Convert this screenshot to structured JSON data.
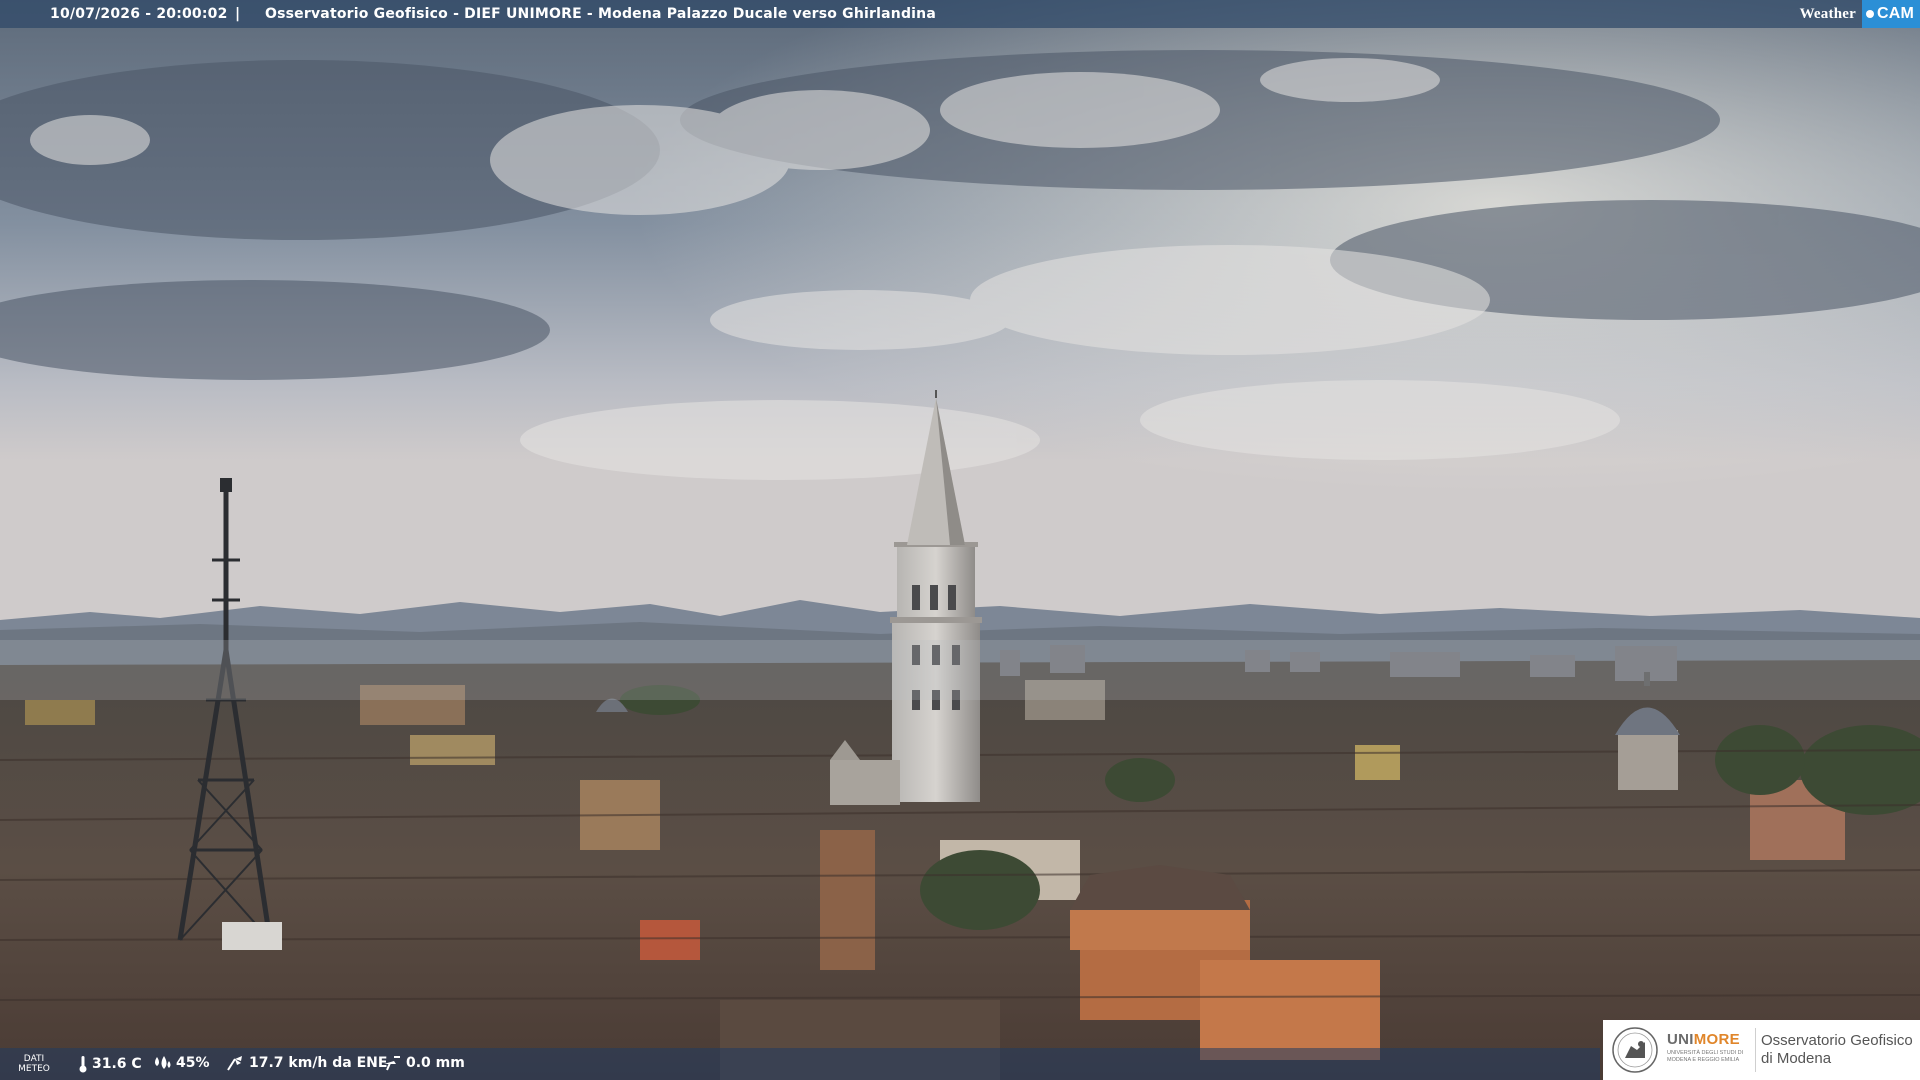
{
  "header": {
    "timestamp": "10/07/2026 - 20:00:02",
    "separator": "|",
    "title": "Osservatorio Geofisico - DIEF UNIMORE - Modena Palazzo Ducale verso Ghirlandina",
    "brand_a": "Weather",
    "brand_b": "CAM"
  },
  "weather": {
    "label_line1": "DATI",
    "label_line2": "METEO",
    "temperature": "31.6 C",
    "humidity": "45%",
    "wind": "17.7 km/h da ENE",
    "rain": "0.0 mm"
  },
  "logo": {
    "uni_part1": "UNI",
    "uni_part2": "MORE",
    "uni_subtitle": "UNIVERSITÀ DEGLI STUDI DI MODENA E REGGIO EMILIA",
    "obs_line1": "Osservatorio Geofisico",
    "obs_line2": "di Modena"
  },
  "colors": {
    "uni_orange": "#e0862b",
    "weathercam_blue": "#2b8fd6"
  },
  "icons": [
    "thermometer-icon",
    "humidity-drop-icon",
    "wind-icon",
    "rain-gauge-icon",
    "university-seal-icon"
  ]
}
